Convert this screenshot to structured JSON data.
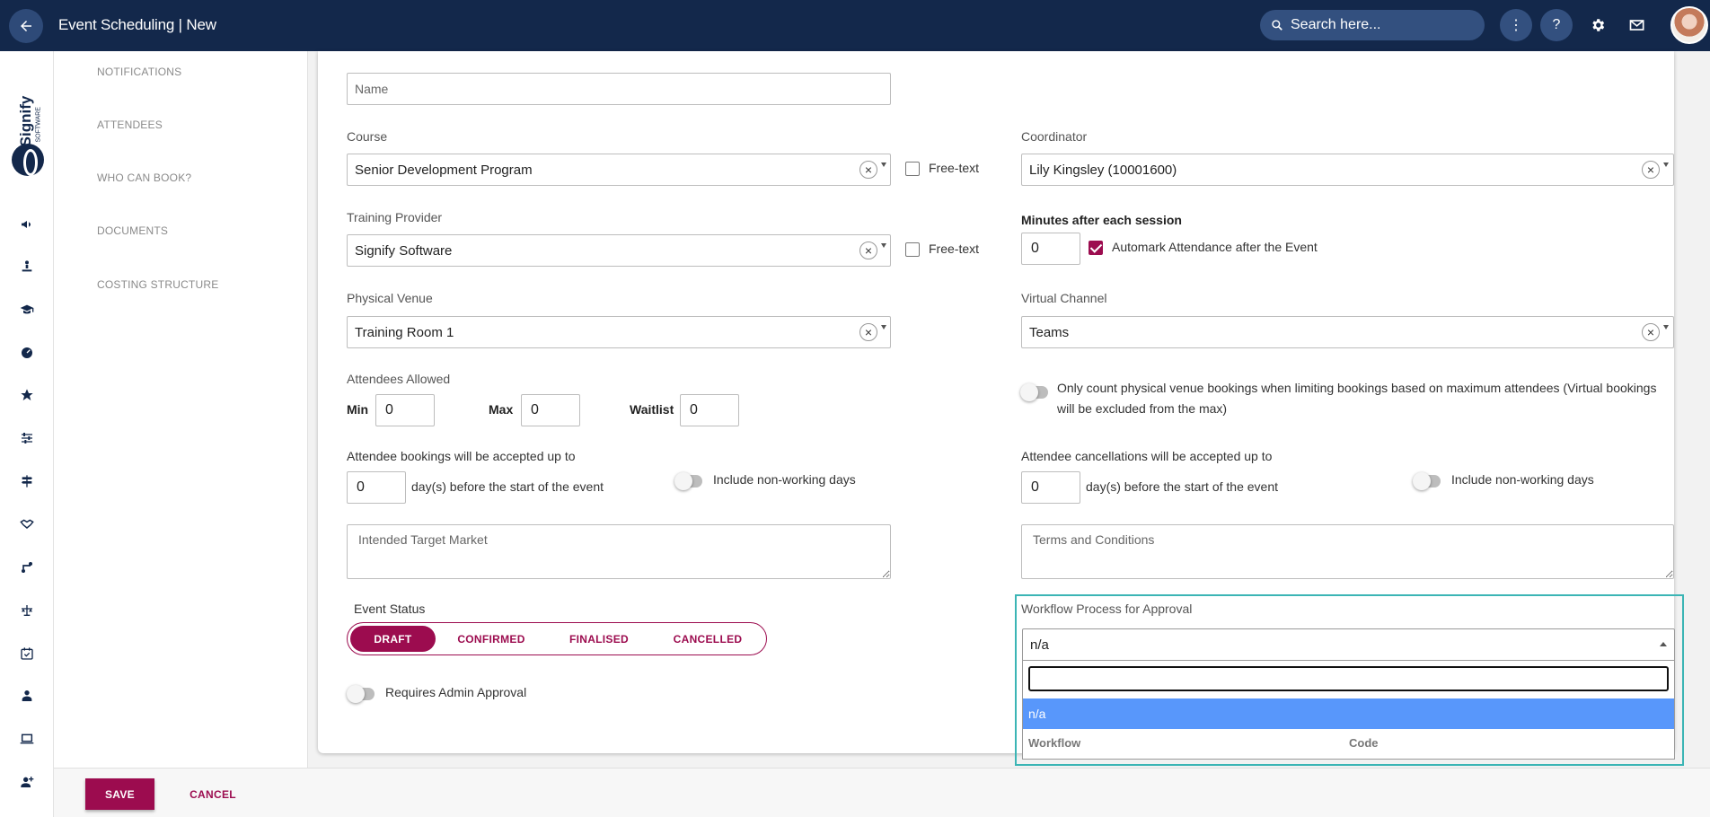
{
  "header": {
    "title": "Event Scheduling | New",
    "search_placeholder": "Search here...",
    "more_label": "⋮",
    "help_label": "?"
  },
  "logo": {
    "name": "Signify",
    "sub": "SOFTWARE"
  },
  "subnav": {
    "items": [
      "NOTIFICATIONS",
      "ATTENDEES",
      "WHO CAN BOOK?",
      "DOCUMENTS",
      "COSTING STRUCTURE"
    ]
  },
  "form": {
    "name_placeholder": "Name",
    "course": {
      "label": "Course",
      "value": "Senior Development Program",
      "freetext_label": "Free-text"
    },
    "coordinator": {
      "label": "Coordinator",
      "value": "Lily Kingsley (10001600)"
    },
    "training_provider": {
      "label": "Training Provider",
      "value": "Signify Software",
      "freetext_label": "Free-text"
    },
    "minutes_after": {
      "label": "Minutes after each session",
      "value": "0",
      "automark_label": "Automark Attendance after the Event"
    },
    "physical_venue": {
      "label": "Physical Venue",
      "value": "Training Room 1"
    },
    "virtual_channel": {
      "label": "Virtual Channel",
      "value": "Teams"
    },
    "attendees": {
      "label": "Attendees Allowed",
      "min_label": "Min",
      "min_value": "0",
      "max_label": "Max",
      "max_value": "0",
      "waitlist_label": "Waitlist",
      "waitlist_value": "0"
    },
    "only_count_label": "Only count physical venue bookings when limiting bookings based on maximum attendees (Virtual bookings will be excluded from the max)",
    "bookings": {
      "label": "Attendee bookings will be accepted up to",
      "value": "0",
      "days_label": "day(s) before the start of the event",
      "nonworking_label": "Include non-working days"
    },
    "cancellations": {
      "label": "Attendee cancellations will be accepted up to",
      "value": "0",
      "days_label": "day(s) before the start of the event",
      "nonworking_label": "Include non-working days"
    },
    "target_market_placeholder": "Intended Target Market",
    "terms_placeholder": "Terms and Conditions",
    "event_status": {
      "label": "Event Status",
      "options": [
        "DRAFT",
        "CONFIRMED",
        "FINALISED",
        "CANCELLED"
      ],
      "selected": "DRAFT"
    },
    "requires_admin_label": "Requires Admin Approval",
    "workflow": {
      "label": "Workflow Process for Approval",
      "value": "n/a",
      "search_value": "",
      "option": "n/a",
      "col_workflow": "Workflow",
      "col_code": "Code"
    }
  },
  "footer": {
    "save_label": "SAVE",
    "cancel_label": "CANCEL"
  },
  "colors": {
    "navy": "#13284b",
    "accent": "#9c0c4f",
    "highlight": "#3bb5b5",
    "option_selected": "#5897fb"
  }
}
